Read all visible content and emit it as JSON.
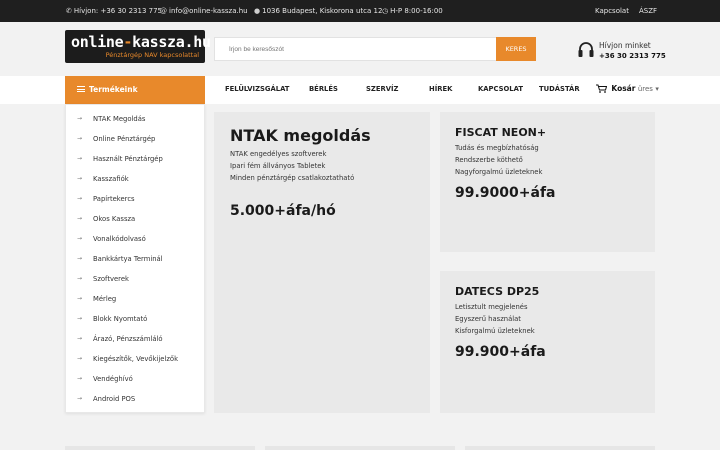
{
  "topbar": {
    "phone": "Hívjon: +36 30 2313 775",
    "email": "info@online-kassza.hu",
    "address": "1036 Budapest, Kiskorona utca 12.",
    "hours": "H-P 8:00-16:00",
    "contact": "Kapcsolat",
    "terms": "ÁSZF"
  },
  "header": {
    "brand_left": "online",
    "brand_dash": "-",
    "brand_right": "kassza.hu",
    "tagline": "Pénztárgép NAV kapcsolattal",
    "search_placeholder": "Írjon be keresőszót",
    "search_button": "KERES",
    "call_label": "Hívjon minket",
    "call_number": "+36 30 2313 775"
  },
  "nav": {
    "products": "Termékeink",
    "links": [
      "FELÜLVIZSGÁLAT",
      "BÉRLÉS",
      "SZERVÍZ",
      "HÍREK",
      "KAPCSOLAT",
      "TUDÁSTÁR"
    ],
    "cart_label": "Kosár",
    "cart_status": "üres"
  },
  "sidebar": {
    "items": [
      "NTAK Megoldás",
      "Online Pénztárgép",
      "Használt Pénztárgép",
      "Kasszafiók",
      "Papírtekercs",
      "Okos Kassza",
      "Vonalkódolvasó",
      "Bankkártya Terminál",
      "Szoftverek",
      "Mérleg",
      "Blokk Nyomtató",
      "Árazó, Pénzszámláló",
      "Kiegészítők, Vevőkijelzők",
      "Vendéghívó",
      "Android POS"
    ]
  },
  "promos": {
    "ntak": {
      "title": "NTAK megoldás",
      "lines": [
        "NTAK engedélyes szoftverek",
        "Ipari fém állványos Tabletek",
        "Minden pénztárgép csatlakoztatható"
      ],
      "price": "5.000+áfa/hó"
    },
    "fiscat": {
      "title": "FISCAT NEON+",
      "lines": [
        "Tudás és megbízhatóság",
        "Rendszerbe köthető",
        "Nagyforgalmú üzleteknek"
      ],
      "price": "99.9000+áfa"
    },
    "datecs": {
      "title": "DATECS DP25",
      "lines": [
        "Letisztult megjelenés",
        "Egyszerű használat",
        "Kisforgalmú üzleteknek"
      ],
      "price": "99.900+áfa"
    }
  },
  "colors": {
    "accent": "#e8892b",
    "topbar": "#1f1f1f",
    "panel": "#e9e9e9"
  }
}
